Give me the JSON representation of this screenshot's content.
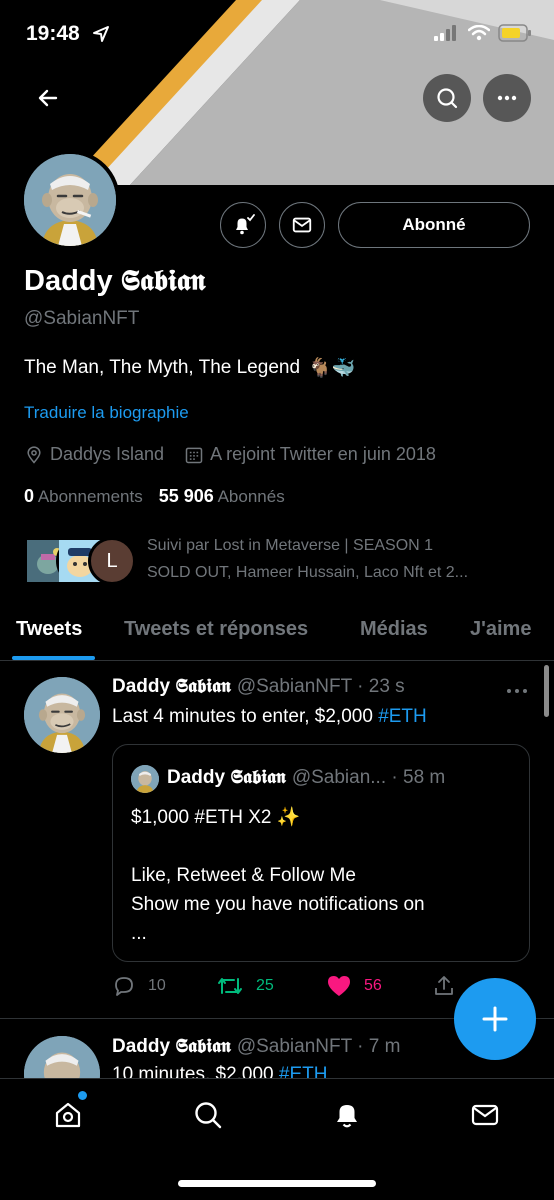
{
  "status_bar": {
    "time": "19:48"
  },
  "profile": {
    "display_name": "Daddy 𝕾𝖆𝖇𝖎𝖆𝖓",
    "handle": "@SabianNFT",
    "bio": "The Man, The Myth, The Legend",
    "bio_emojis": "🐐🐳",
    "translate_label": "Traduire la biographie",
    "location": "Daddys Island",
    "joined": "A rejoint Twitter en juin 2018",
    "following_count": "0",
    "following_label": "Abonnements",
    "followers_count": "55 906",
    "followers_label": "Abonnés",
    "follow_button": "Abonné",
    "followed_by_line1": "Suivi par Lost in Metaverse | SEASON 1",
    "followed_by_line2": "SOLD OUT, Hameer Hussain, Laco Nft et 2...",
    "follower_initial": "L"
  },
  "tabs": [
    {
      "label": "Tweets"
    },
    {
      "label": "Tweets et réponses"
    },
    {
      "label": "Médias"
    },
    {
      "label": "J'aime"
    }
  ],
  "tweets": [
    {
      "name": "Daddy 𝕾𝖆𝖇𝖎𝖆𝖓",
      "meta": "@SabianNFT · 23 s",
      "text": "Last 4 minutes to enter, $2,000",
      "hashtag": "#ETH",
      "quote": {
        "name": "Daddy 𝕾𝖆𝖇𝖎𝖆𝖓",
        "meta": "@Sabian... · 58 m",
        "line1": "$1,000 #ETH X2 ✨",
        "line2": "Like, Retweet & Follow Me",
        "line3": "Show me you have notifications on",
        "line4": "..."
      },
      "replies": "10",
      "retweets": "25",
      "likes": "56"
    },
    {
      "name": "Daddy 𝕾𝖆𝖇𝖎𝖆𝖓",
      "meta": "@SabianNFT · 7 m",
      "text": "10 minutes, $2,000",
      "hashtag": "#ETH"
    }
  ],
  "colors": {
    "accent": "#1d9bf0",
    "retweet": "#00ba7c",
    "like": "#f91880",
    "banner_orange": "#e8a93a",
    "banner_gray": "#a9a9a9"
  }
}
